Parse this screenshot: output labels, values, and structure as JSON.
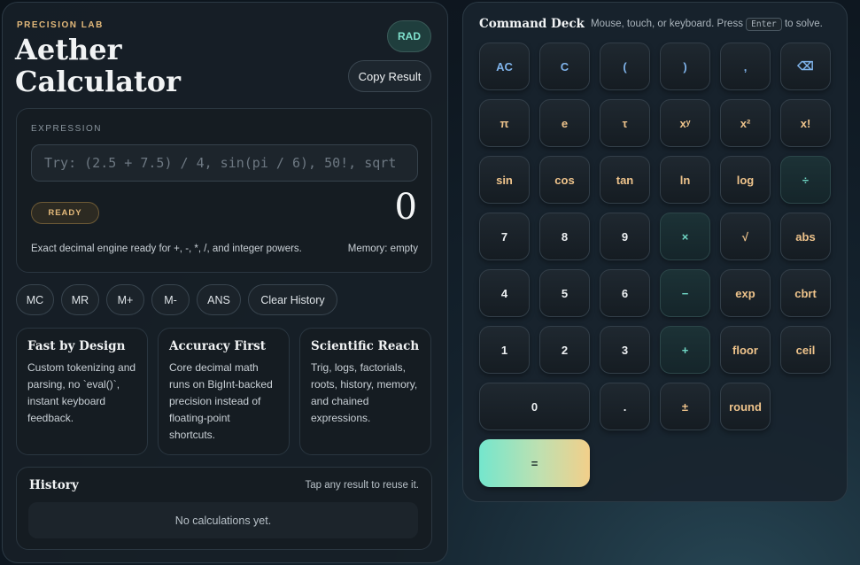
{
  "header": {
    "kicker": "PRECISION LAB",
    "title_line1": "Aether",
    "title_line2": "Calculator",
    "angle_mode": "RAD",
    "copy_label": "Copy Result"
  },
  "expression": {
    "label": "EXPRESSION",
    "value": "",
    "placeholder": "Try: (2.5 + 7.5) / 4, sin(pi / 6), 50!, sqrt",
    "state": "READY",
    "result": "0",
    "status_text": "Exact decimal engine ready for +, -, *, /, and integer powers.",
    "memory_text": "Memory: empty"
  },
  "memory_buttons": [
    "MC",
    "MR",
    "M+",
    "M-",
    "ANS",
    "Clear History"
  ],
  "features": [
    {
      "title": "Fast by Design",
      "text": "Custom tokenizing and parsing, no `eval()`, instant keyboard feedback."
    },
    {
      "title": "Accuracy First",
      "text": "Core decimal math runs on BigInt-backed precision instead of floating-point shortcuts."
    },
    {
      "title": "Scientific Reach",
      "text": "Trig, logs, factorials, roots, history, memory, and chained expressions."
    }
  ],
  "history": {
    "title": "History",
    "hint": "Tap any result to reuse it.",
    "empty": "No calculations yet."
  },
  "deck": {
    "title": "Command Deck",
    "hint_before": "Mouse, touch, or keyboard. Press",
    "hint_key": "Enter",
    "hint_after": "to solve."
  },
  "keys": [
    {
      "label": "AC",
      "style": "blue"
    },
    {
      "label": "C",
      "style": "blue"
    },
    {
      "label": "(",
      "style": "blue"
    },
    {
      "label": ")",
      "style": "blue"
    },
    {
      "label": ",",
      "style": "blue"
    },
    {
      "label": "⌫",
      "style": "blue"
    },
    {
      "label": "π",
      "style": "gold"
    },
    {
      "label": "e",
      "style": "gold"
    },
    {
      "label": "τ",
      "style": "gold"
    },
    {
      "label": "xʸ",
      "style": "gold"
    },
    {
      "label": "x²",
      "style": "gold"
    },
    {
      "label": "x!",
      "style": "gold"
    },
    {
      "label": "sin",
      "style": "gold"
    },
    {
      "label": "cos",
      "style": "gold"
    },
    {
      "label": "tan",
      "style": "gold"
    },
    {
      "label": "ln",
      "style": "gold"
    },
    {
      "label": "log",
      "style": "gold"
    },
    {
      "label": "÷",
      "style": "teal"
    },
    {
      "label": "7",
      "style": "num"
    },
    {
      "label": "8",
      "style": "num"
    },
    {
      "label": "9",
      "style": "num"
    },
    {
      "label": "×",
      "style": "teal"
    },
    {
      "label": "√",
      "style": "gold"
    },
    {
      "label": "abs",
      "style": "gold"
    },
    {
      "label": "4",
      "style": "num"
    },
    {
      "label": "5",
      "style": "num"
    },
    {
      "label": "6",
      "style": "num"
    },
    {
      "label": "−",
      "style": "teal"
    },
    {
      "label": "exp",
      "style": "gold"
    },
    {
      "label": "cbrt",
      "style": "gold"
    },
    {
      "label": "1",
      "style": "num"
    },
    {
      "label": "2",
      "style": "num"
    },
    {
      "label": "3",
      "style": "num"
    },
    {
      "label": "+",
      "style": "teal"
    },
    {
      "label": "floor",
      "style": "gold"
    },
    {
      "label": "ceil",
      "style": "gold"
    },
    {
      "label": "0",
      "style": "num"
    },
    {
      "label": ".",
      "style": "num"
    },
    {
      "label": "±",
      "style": "gold"
    },
    {
      "label": "round",
      "style": "gold"
    },
    {
      "label": "=",
      "style": "equals"
    }
  ],
  "colors": {
    "accent_teal": "#74e6cd",
    "accent_gold": "#eec38b",
    "accent_blue": "#7fb3ea"
  }
}
